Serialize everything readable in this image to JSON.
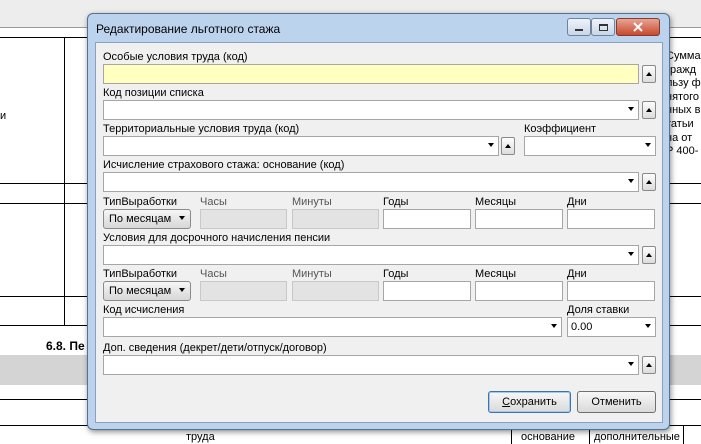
{
  "dialog": {
    "title": "Редактирование льготного стажа",
    "fields": {
      "special_conditions_label": "Особые условия труда (код)",
      "list_position_label": "Код позиции списка",
      "territorial_label": "Территориальные условия труда (код)",
      "coefficient_label": "Коэффициент",
      "insurance_basis_label": "Исчисление страхового стажа: основание (код)",
      "early_pension_label": "Условия для досрочного начисления пенсии",
      "calc_code_label": "Код исчисления",
      "rate_share_label": "Доля ставки",
      "rate_share_value": "0.00",
      "extra_info_label": "Доп. сведения (декрет/дети/отпуск/договор)"
    },
    "work_rows": [
      {
        "type_label": "ТипВыработки",
        "type_value": "По месяцам",
        "hours_label": "Часы",
        "minutes_label": "Минуты",
        "years_label": "Годы",
        "months_label": "Месяцы",
        "days_label": "Дни"
      },
      {
        "type_label": "ТипВыработки",
        "type_value": "По месяцам",
        "hours_label": "Часы",
        "minutes_label": "Минуты",
        "years_label": "Годы",
        "months_label": "Месяцы",
        "days_label": "Дни"
      }
    ],
    "buttons": {
      "save_mnemonic": "С",
      "save_rest": "охранить",
      "cancel_label": "Отменить"
    }
  },
  "background": {
    "right_column": [
      "Сумма",
      "гражд",
      "льзу ф",
      "нятого",
      "нных в",
      "татьи",
      "на от",
      "Р 400-"
    ],
    "left_fragment": "и",
    "section_title": "6.8. Пе",
    "bottom_cells": [
      "труда",
      "основание",
      "дополнительные"
    ]
  }
}
